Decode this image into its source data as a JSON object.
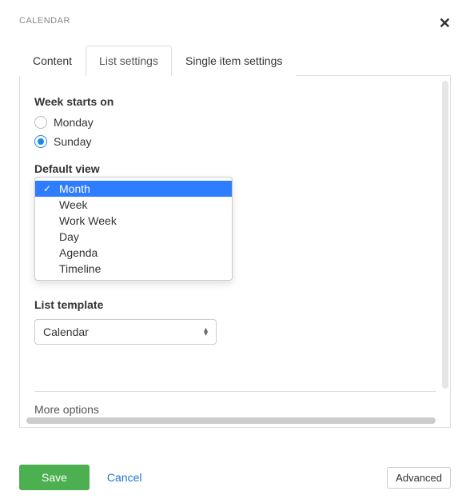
{
  "header": {
    "title": "CALENDAR"
  },
  "tabs": {
    "content": "Content",
    "list_settings": "List settings",
    "single_item": "Single item settings"
  },
  "week_starts": {
    "label": "Week starts on",
    "monday": "Monday",
    "sunday": "Sunday",
    "selected": "sunday"
  },
  "default_view": {
    "label": "Default view",
    "options": [
      "Month",
      "Week",
      "Work Week",
      "Day",
      "Agenda",
      "Timeline"
    ],
    "selected": "Month"
  },
  "list_template": {
    "label": "List template",
    "value": "Calendar"
  },
  "more_options": "More options",
  "footer": {
    "save": "Save",
    "cancel": "Cancel",
    "advanced": "Advanced"
  }
}
